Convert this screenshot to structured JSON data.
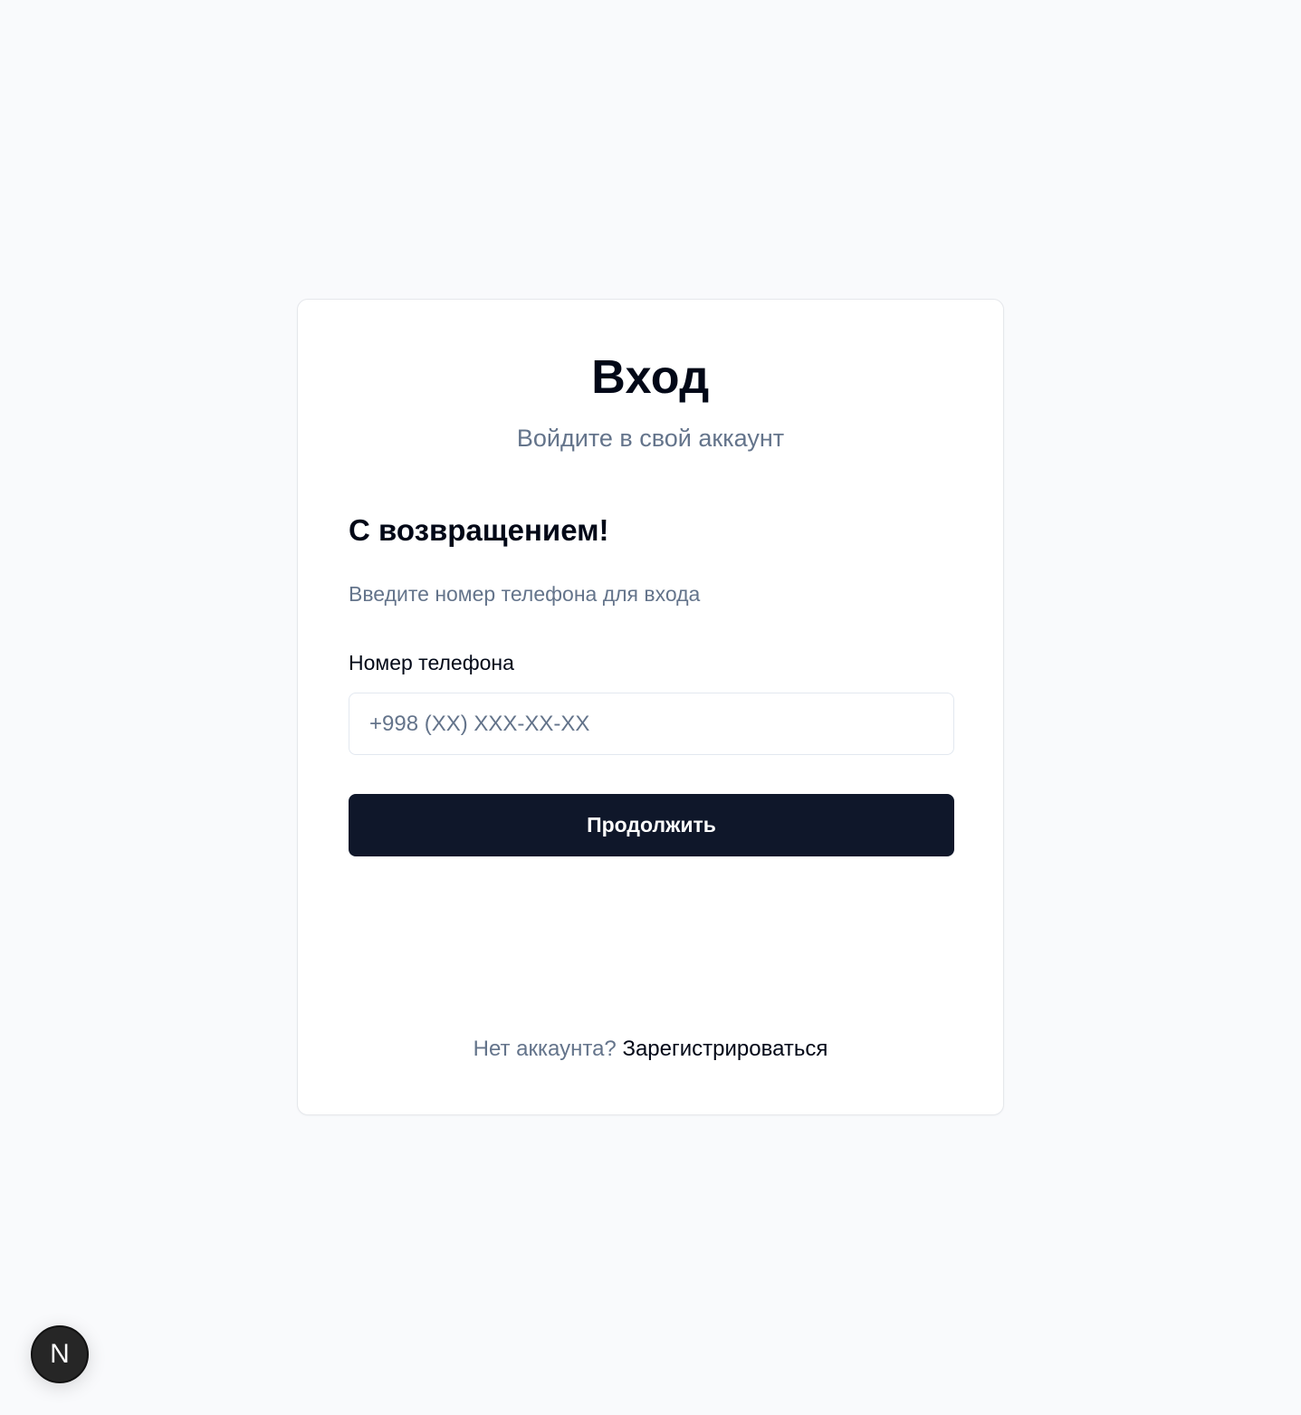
{
  "header": {
    "title": "Вход",
    "subtitle": "Войдите в свой аккаунт"
  },
  "form": {
    "welcome": "С возвращением!",
    "description": "Введите номер телефона для входа",
    "phone_label": "Номер телефона",
    "phone_value": "",
    "phone_placeholder": "+998 (XX) XXX-XX-XX",
    "submit_label": "Продолжить"
  },
  "footer": {
    "question": "Нет аккаунта?",
    "register_link": "Зарегистрироваться"
  },
  "dev_badge": {
    "letter": "N",
    "icon": "nextjs-logo-icon"
  },
  "colors": {
    "primary": "#0f172a",
    "muted": "#64748b",
    "background": "#f9fafc"
  }
}
